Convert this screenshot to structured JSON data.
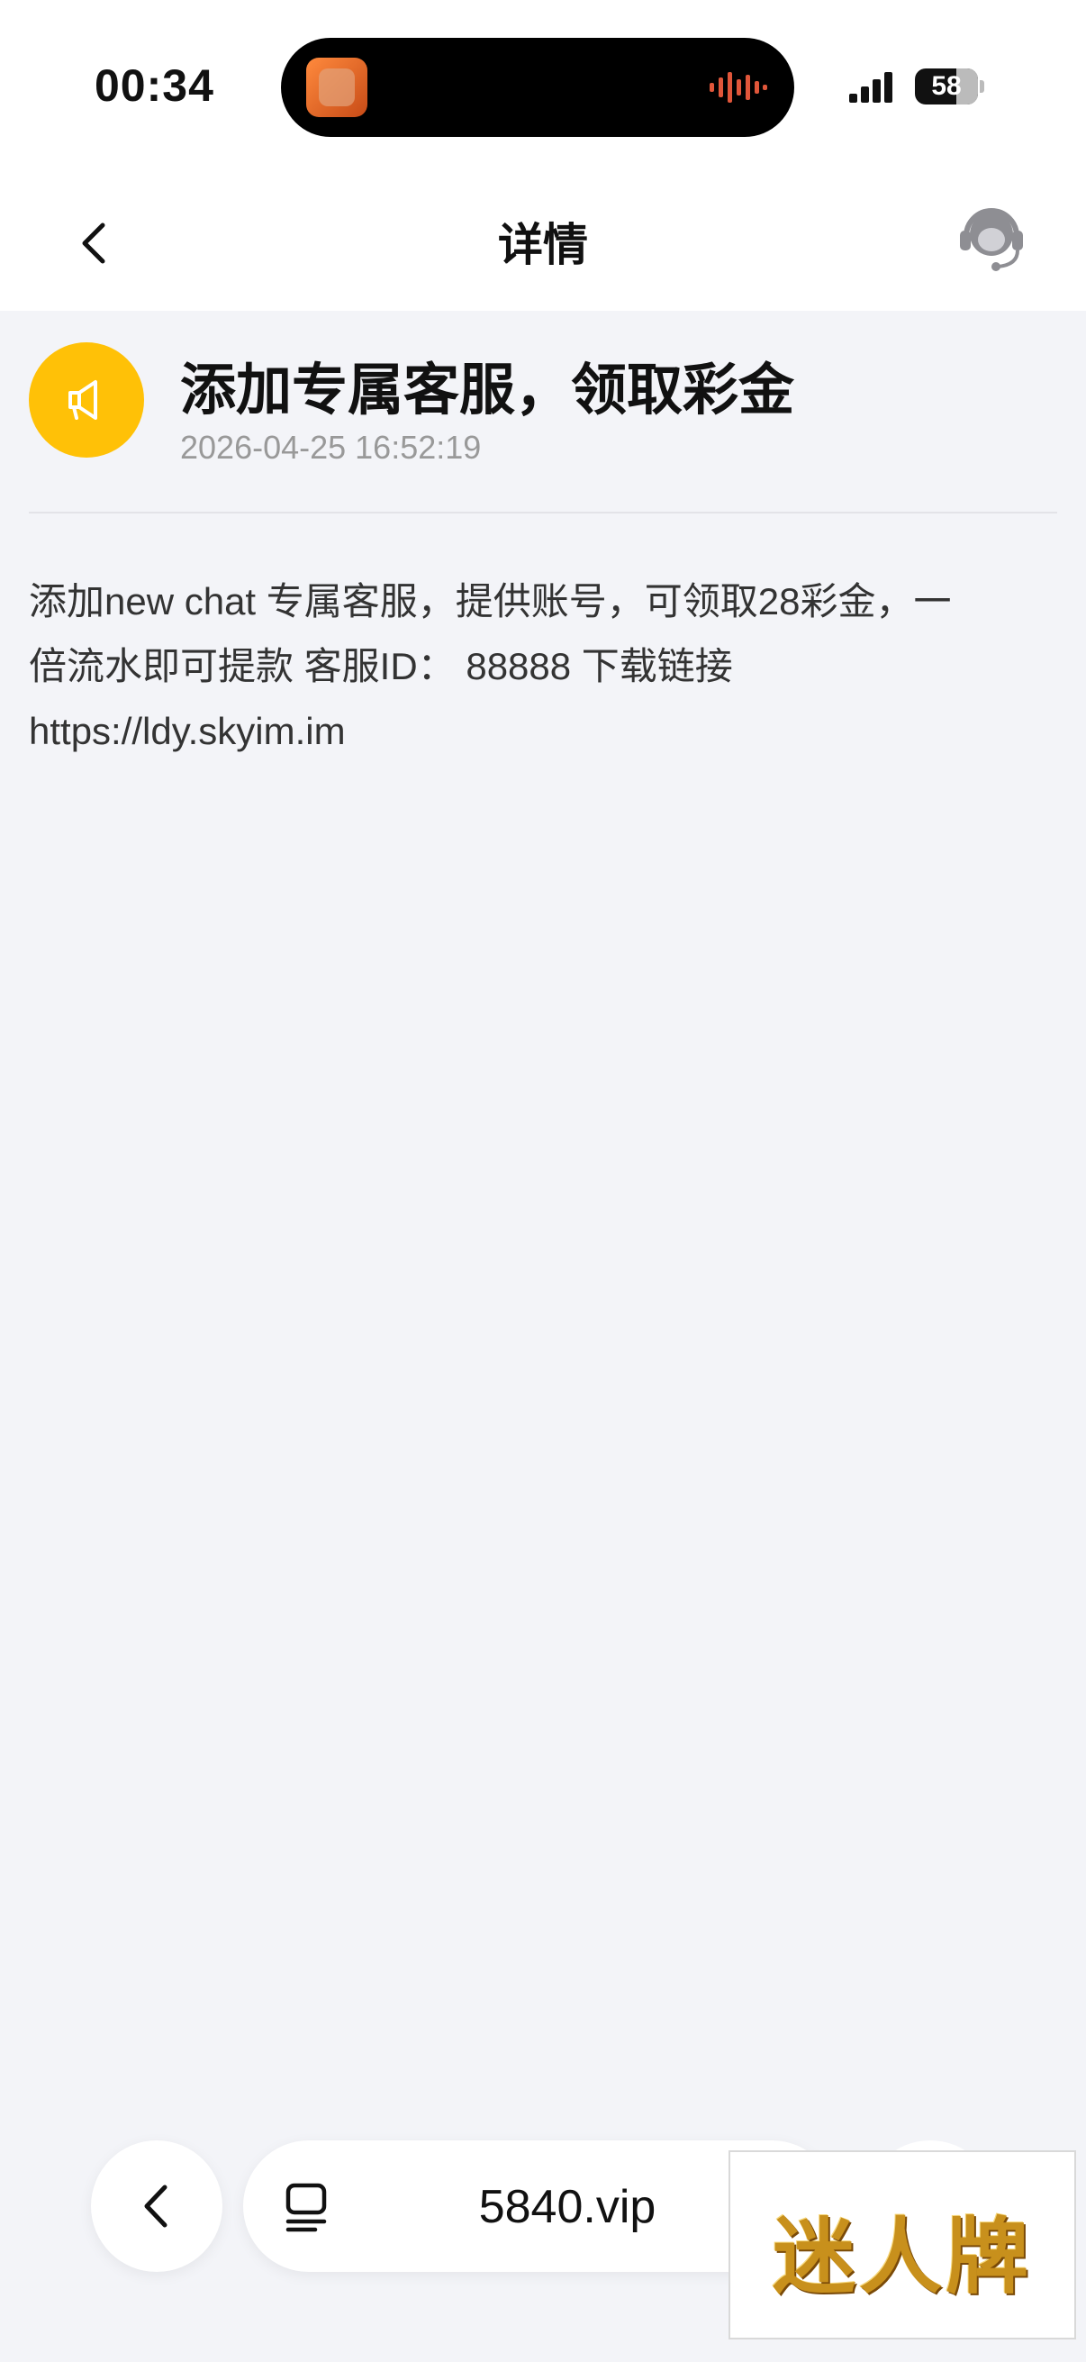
{
  "status_bar": {
    "time": "00:34",
    "battery": "58"
  },
  "nav": {
    "title": "详情"
  },
  "message": {
    "title": "添加专属客服，领取彩金",
    "timestamp": "2026-04-25 16:52:19",
    "body_line1": "添加new chat 专属客服，提供账号，可领取28彩金，一",
    "body_line2": "倍流水即可提款 客服ID：  88888 下载链接",
    "body_line3": "https://ldy.skyim.im"
  },
  "browser_bar": {
    "url": "5840.vip"
  },
  "ad_overlay": {
    "text": "迷人牌"
  },
  "colors": {
    "accent": "#ffc107",
    "background": "#f3f4f8"
  },
  "icons": [
    "back-chevron-icon",
    "customer-service-icon",
    "megaphone-icon",
    "tabs-icon",
    "signal-icon",
    "battery-icon"
  ]
}
